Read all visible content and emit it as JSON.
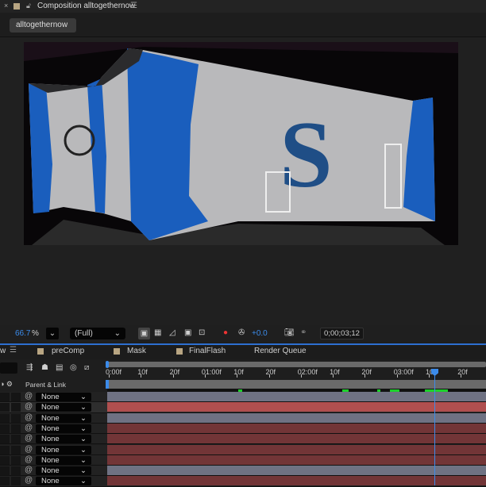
{
  "window": {
    "close": "×",
    "title": "Composition alltogethernow",
    "menu": "☰"
  },
  "comp_tab": "alltogethernow",
  "toolbar": {
    "zoom": "66.7",
    "zoom_unit": "%",
    "resolution": "(Full)",
    "exposure": "+0.0",
    "timecode": "0;00;03;12",
    "accent": "#3b8bea"
  },
  "panel_tabs": [
    {
      "label": "preComp",
      "color": "#b8a582"
    },
    {
      "label": "Mask",
      "color": "#b8a582"
    },
    {
      "label": "FinalFlash",
      "color": "#b8a582"
    },
    {
      "label": "Render Queue"
    }
  ],
  "panel_left_fragment": "w",
  "column_header": "Parent & Link",
  "ruler_labels": [
    "0:00f",
    "10f",
    "20f",
    "01:00f",
    "10f",
    "20f",
    "02:00f",
    "10f",
    "20f",
    "03:00f",
    "10f",
    "20f"
  ],
  "layers": [
    {
      "parent": "None",
      "color": "#6f7283"
    },
    {
      "parent": "None",
      "color": "#b04f4f",
      "selected": true
    },
    {
      "parent": "None",
      "color": "#6f7283"
    },
    {
      "parent": "None",
      "color": "#723537"
    },
    {
      "parent": "None",
      "color": "#723537"
    },
    {
      "parent": "None",
      "color": "#723537"
    },
    {
      "parent": "None",
      "color": "#723537"
    },
    {
      "parent": "None",
      "color": "#6f7283"
    },
    {
      "parent": "None",
      "color": "#723537"
    }
  ]
}
